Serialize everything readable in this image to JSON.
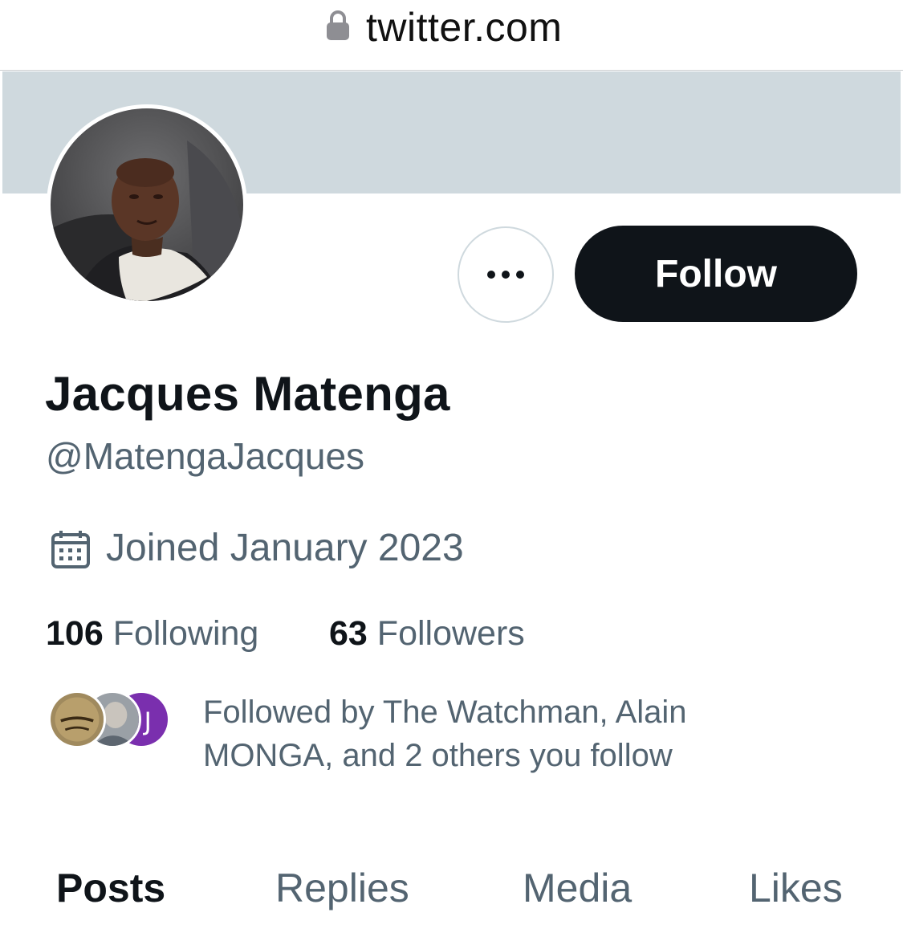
{
  "browser": {
    "url": "twitter.com",
    "lock_icon": "lock-icon"
  },
  "profile": {
    "banner_color": "#cfd9de",
    "avatar_icon": "profile-photo",
    "display_name": "Jacques Matenga",
    "handle": "@MatengaJacques",
    "joined_icon": "calendar-icon",
    "joined": "Joined January 2023",
    "following_count": "106",
    "following_label": "Following",
    "followers_count": "63",
    "followers_label": "Followers",
    "followed_by": "Followed by The Watchman, Alain MONGA, and 2 others you follow"
  },
  "actions": {
    "more_icon": "more-horizontal-icon",
    "follow_label": "Follow",
    "follow_bg": "#0f1419"
  },
  "tabs": [
    {
      "label": "Posts",
      "active": true
    },
    {
      "label": "Replies",
      "active": false
    },
    {
      "label": "Media",
      "active": false
    },
    {
      "label": "Likes",
      "active": false
    }
  ],
  "colors": {
    "primary_text": "#0f1419",
    "secondary_text": "#536471"
  }
}
